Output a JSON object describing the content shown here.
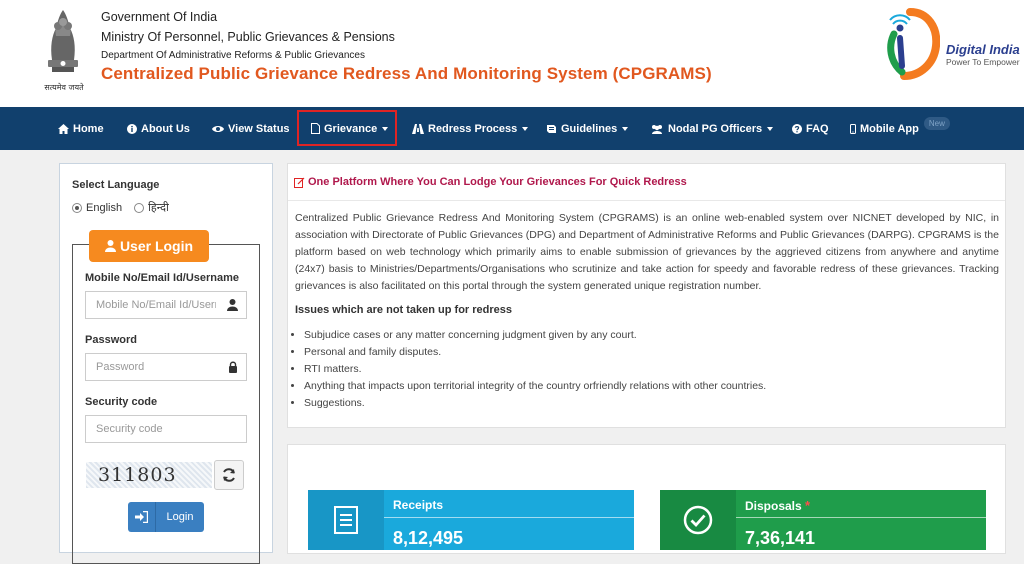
{
  "header": {
    "emblem_caption": "सत्यमेव जयते",
    "line1": "Government Of India",
    "line2": "Ministry Of Personnel, Public Grievances & Pensions",
    "line3": "Department Of Administrative Reforms & Public Grievances",
    "title": "Centralized Public Grievance Redress And Monitoring System (CPGRAMS)",
    "digital_india_name": "Digital India",
    "digital_india_tag": "Power To Empower"
  },
  "nav": {
    "items": [
      {
        "label": "Home",
        "icon": "home-icon"
      },
      {
        "label": "About Us",
        "icon": "info-icon"
      },
      {
        "label": "View Status",
        "icon": "eye-icon"
      },
      {
        "label": "Grievance",
        "icon": "document-icon",
        "dropdown": true,
        "highlighted": true
      },
      {
        "label": "Redress Process",
        "icon": "process-icon",
        "dropdown": true
      },
      {
        "label": "Guidelines",
        "icon": "book-icon",
        "dropdown": true
      },
      {
        "label": "Nodal PG Officers",
        "icon": "users-icon",
        "dropdown": true
      },
      {
        "label": "FAQ",
        "icon": "question-icon"
      },
      {
        "label": "Mobile App",
        "icon": "mobile-icon",
        "badge": "New"
      }
    ]
  },
  "login": {
    "language_label": "Select Language",
    "languages": [
      {
        "label": "English",
        "selected": true
      },
      {
        "label": "हिन्दी",
        "selected": false
      }
    ],
    "user_login_label": "User Login",
    "username_label": "Mobile No/Email Id/Username",
    "username_placeholder": "Mobile No/Email Id/Username",
    "password_label": "Password",
    "password_placeholder": "Password",
    "security_label": "Security code",
    "security_placeholder": "Security code",
    "captcha_value": "311803",
    "login_button": "Login"
  },
  "info": {
    "heading": "One Platform Where You Can Lodge Your Grievances For Quick Redress",
    "paragraph": "Centralized Public Grievance Redress And Monitoring System (CPGRAMS) is an online web-enabled system over NICNET developed by NIC, in association with Directorate of Public Grievances (DPG) and Department of Administrative Reforms and Public Grievances (DARPG). CPGRAMS is the platform based on web technology which primarily aims to enable submission of grievances by the aggrieved citizens from anywhere and anytime (24x7) basis to Ministries/Departments/Organisations who scrutinize and take action for speedy and favorable redress of these grievances. Tracking grievances is also facilitated on this portal through the system generated unique registration number.",
    "issues_heading": "Issues which are not taken up for redress",
    "issues": [
      "Subjudice cases or any matter concerning judgment given by any court.",
      "Personal and family disputes.",
      "RTI matters.",
      "Anything that impacts upon territorial integrity of the country orfriendly relations with other countries.",
      "Suggestions."
    ]
  },
  "stats": {
    "receipts_title": "Receipts",
    "receipts_value": "8,12,495",
    "disposals_title": "Disposals",
    "disposals_mark": "*",
    "disposals_value": "7,36,141"
  },
  "colors": {
    "nav_bg": "#11406d",
    "title_orange": "#e1581f",
    "login_orange": "#f68a1f",
    "heading_maroon": "#b0184c",
    "receipts_blue": "#1aa9dc",
    "disposals_green": "#1f9d4b",
    "highlight_red": "#e02424"
  }
}
